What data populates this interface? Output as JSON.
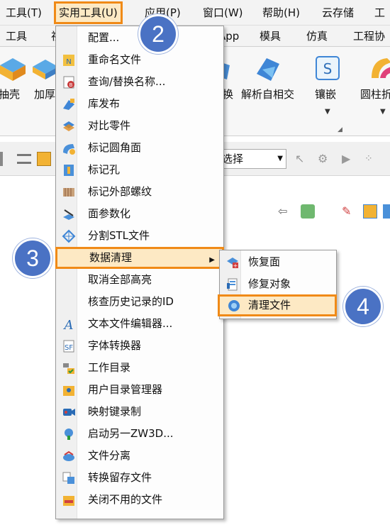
{
  "menubar": {
    "items": [
      "工具(T)",
      "实用工具(U)",
      "应用(P)",
      "窗口(W)",
      "帮助(H)",
      "云存储",
      "工"
    ]
  },
  "tabs": [
    "工具",
    "视",
    "App",
    "模具",
    "仿真",
    "工程协"
  ],
  "ribbon": {
    "buttons": [
      "抽壳",
      "加厚",
      "换",
      "解析自相交",
      "镶嵌",
      "圆柱折"
    ]
  },
  "toolbar": {
    "filter_value": "选择"
  },
  "utilities_menu": {
    "items": [
      {
        "label": "配置...",
        "icon": "config-icon"
      },
      {
        "label": "重命名文件",
        "icon": "rename-file-icon"
      },
      {
        "label": "查询/替换名称...",
        "icon": "query-replace-icon"
      },
      {
        "label": "库发布",
        "icon": "library-publish-icon"
      },
      {
        "label": "对比零件",
        "icon": "compare-parts-icon"
      },
      {
        "label": "标记圆角面",
        "icon": "mark-fillet-icon"
      },
      {
        "label": "标记孔",
        "icon": "mark-hole-icon"
      },
      {
        "label": "标记外部螺纹",
        "icon": "mark-thread-icon"
      },
      {
        "label": "面参数化",
        "icon": "face-param-icon"
      },
      {
        "label": "分割STL文件",
        "icon": "split-stl-icon"
      },
      {
        "label": "数据清理",
        "icon": "",
        "submenu": true
      },
      {
        "label": "取消全部高亮",
        "icon": ""
      },
      {
        "label": "核查历史记录的ID",
        "icon": ""
      },
      {
        "label": "文本文件编辑器...",
        "icon": "text-editor-icon"
      },
      {
        "label": "字体转换器",
        "icon": "font-converter-icon"
      },
      {
        "label": "工作目录",
        "icon": "work-dir-icon"
      },
      {
        "label": "用户目录管理器",
        "icon": "user-dir-icon"
      },
      {
        "label": "映射键录制",
        "icon": "map-key-icon"
      },
      {
        "label": "启动另一ZW3D...",
        "icon": "launch-icon"
      },
      {
        "label": "文件分离",
        "icon": "file-split-icon"
      },
      {
        "label": "转换留存文件",
        "icon": "convert-file-icon"
      },
      {
        "label": "关闭不用的文件",
        "icon": "close-unused-icon"
      }
    ]
  },
  "data_cleanup_submenu": {
    "items": [
      {
        "label": "恢复面",
        "icon": "restore-face-icon"
      },
      {
        "label": "修复对象",
        "icon": "repair-object-icon"
      },
      {
        "label": "清理文件",
        "icon": "clean-file-icon"
      }
    ]
  },
  "callouts": [
    "2",
    "3",
    "4"
  ],
  "colors": {
    "highlight_border": "#f08a17",
    "highlight_fill": "#fde9c4",
    "callout_blue": "#4a72c4"
  }
}
